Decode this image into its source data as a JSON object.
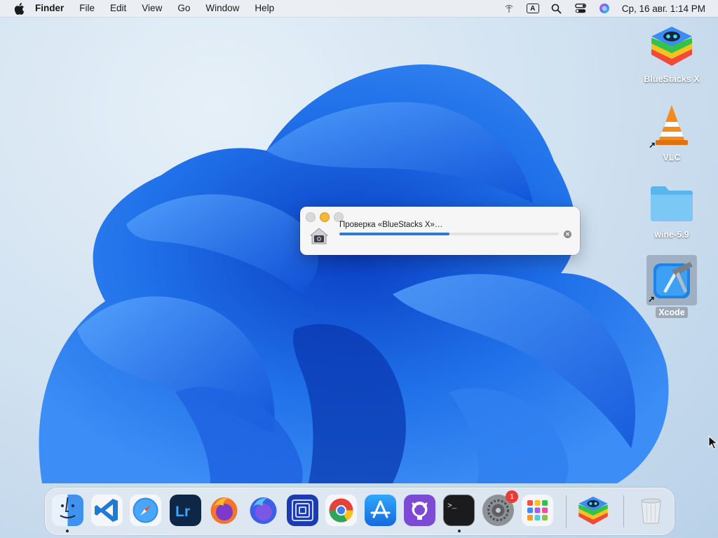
{
  "menubar": {
    "app_name": "Finder",
    "items": [
      "File",
      "Edit",
      "View",
      "Go",
      "Window",
      "Help"
    ],
    "keyboard_layout": "A",
    "clock": "Ср, 16 авг.  1:14 PM"
  },
  "desktop_icons": {
    "bluestacks": "BlueStacks X",
    "vlc": "VLC",
    "wine": "wine-5.9",
    "xcode": "Xcode"
  },
  "dialog": {
    "message": "Проверка «BlueStacks X»…",
    "progress": 0.5
  },
  "dock": {
    "items": [
      "Finder",
      "Visual Studio Code",
      "Safari",
      "Lightroom",
      "Firefox",
      "Firefox Developer Edition",
      "Scrivano",
      "Google Chrome",
      "App Store",
      "GitHub Desktop",
      "Terminal",
      "System Preferences",
      "Launchpad",
      "BlueStacks X",
      "Trash"
    ],
    "system_preferences_badge": "1"
  },
  "colors": {
    "wallpaper_blue": "#1f6fe8",
    "progress_fill": "#2f79cf",
    "minimize_button": "#f6b636",
    "badge": "#ec3b34"
  }
}
